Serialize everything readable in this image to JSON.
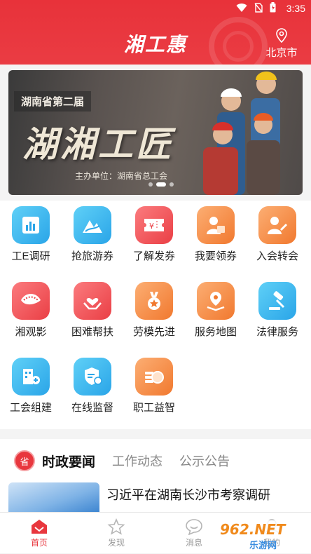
{
  "status_bar": {
    "time": "3:35"
  },
  "header": {
    "title": "湘工惠",
    "city": "北京市",
    "accent": "#e8323a"
  },
  "banner": {
    "tag": "湖南省第二届",
    "headline": "湖湘工匠",
    "host": "主办单位：湖南省总工会"
  },
  "services": [
    {
      "label": "工E调研",
      "icon": "chart-icon",
      "color": "#3ab6ef"
    },
    {
      "label": "抢旅游券",
      "icon": "mountain-icon",
      "color": "#3ab6ef"
    },
    {
      "label": "了解发券",
      "icon": "ticket-icon",
      "color": "#f0585c"
    },
    {
      "label": "我要领券",
      "icon": "person-coupon-icon",
      "color": "#f58a44"
    },
    {
      "label": "入会转会",
      "icon": "person-edit-icon",
      "color": "#f58a44"
    },
    {
      "label": "湘观影",
      "icon": "film-icon",
      "color": "#f0585c"
    },
    {
      "label": "困难帮扶",
      "icon": "heart-hands-icon",
      "color": "#f0585c"
    },
    {
      "label": "劳模先进",
      "icon": "medal-icon",
      "color": "#f58a44"
    },
    {
      "label": "服务地图",
      "icon": "map-pin-icon",
      "color": "#f58a44"
    },
    {
      "label": "法律服务",
      "icon": "gavel-icon",
      "color": "#3ab6ef"
    },
    {
      "label": "工会组建",
      "icon": "building-add-icon",
      "color": "#3ab6ef"
    },
    {
      "label": "在线监督",
      "icon": "shield-chat-icon",
      "color": "#3ab6ef"
    },
    {
      "label": "职工益智",
      "icon": "coin-stack-icon",
      "color": "#f58a44"
    }
  ],
  "news": {
    "seal_text": "省",
    "tabs": [
      "时政要闻",
      "工作动态",
      "公示公告"
    ],
    "active_tab": "时政要闻",
    "headline": "习近平在湖南长沙市考察调研"
  },
  "bottom_nav": [
    {
      "label": "首页",
      "icon": "home-icon",
      "active": true
    },
    {
      "label": "发现",
      "icon": "star-icon",
      "active": false
    },
    {
      "label": "消息",
      "icon": "chat-icon",
      "active": false
    },
    {
      "label": "我的",
      "icon": "user-icon",
      "active": false
    }
  ],
  "watermark": {
    "text": "962.NET",
    "subtext": "乐游网"
  }
}
